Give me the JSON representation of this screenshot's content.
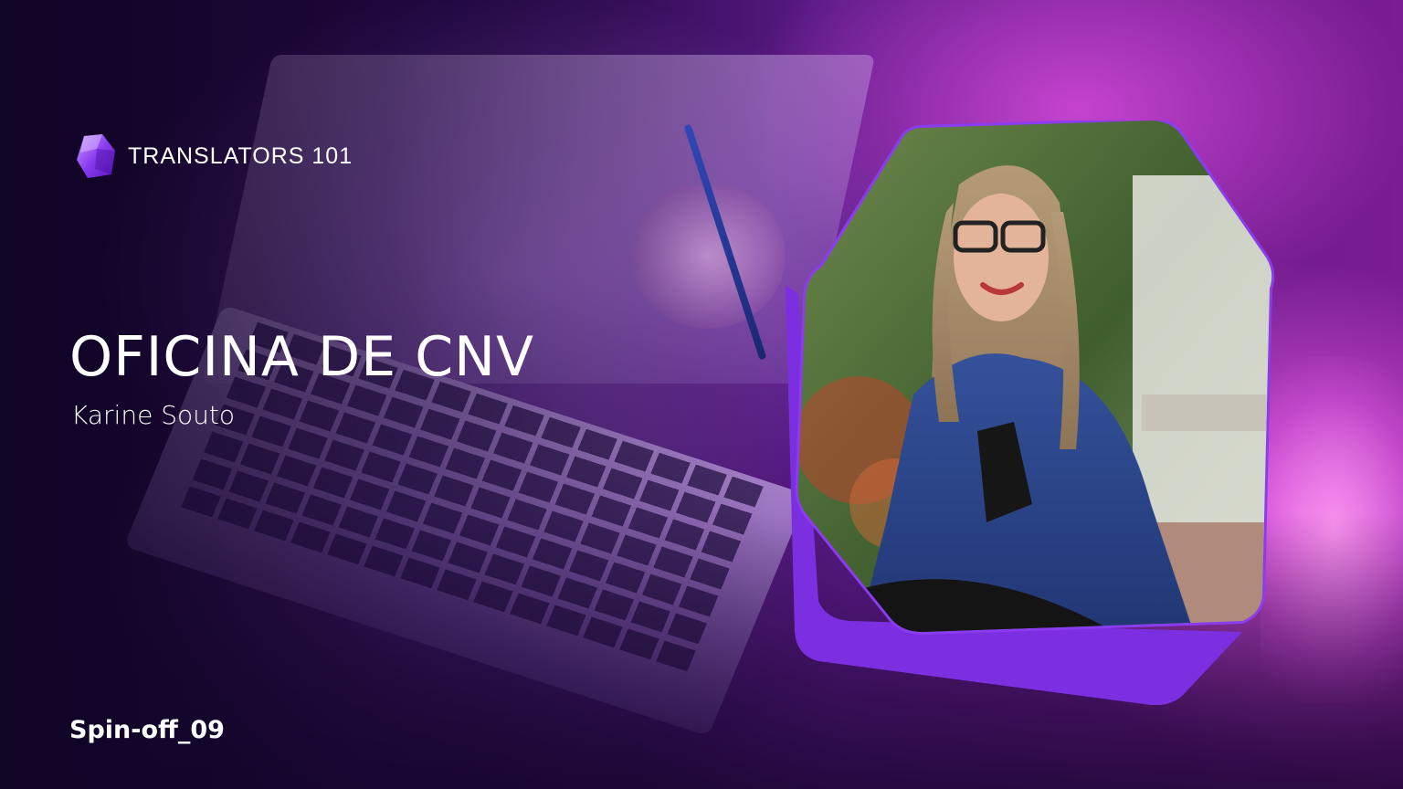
{
  "brand": {
    "name": "TRANSLATORS 101",
    "logo_icon": "hexagon-gem-icon"
  },
  "slide": {
    "title": "OFICINA DE CNV",
    "speaker": "Karine Souto",
    "episode": "Spin-off_09"
  },
  "photo": {
    "subject_icon": "speaker-portrait"
  },
  "colors": {
    "accent": "#7b2fe0",
    "background_dark": "#1a0630",
    "highlight_pink": "#d94ad8",
    "text": "#ffffff"
  }
}
